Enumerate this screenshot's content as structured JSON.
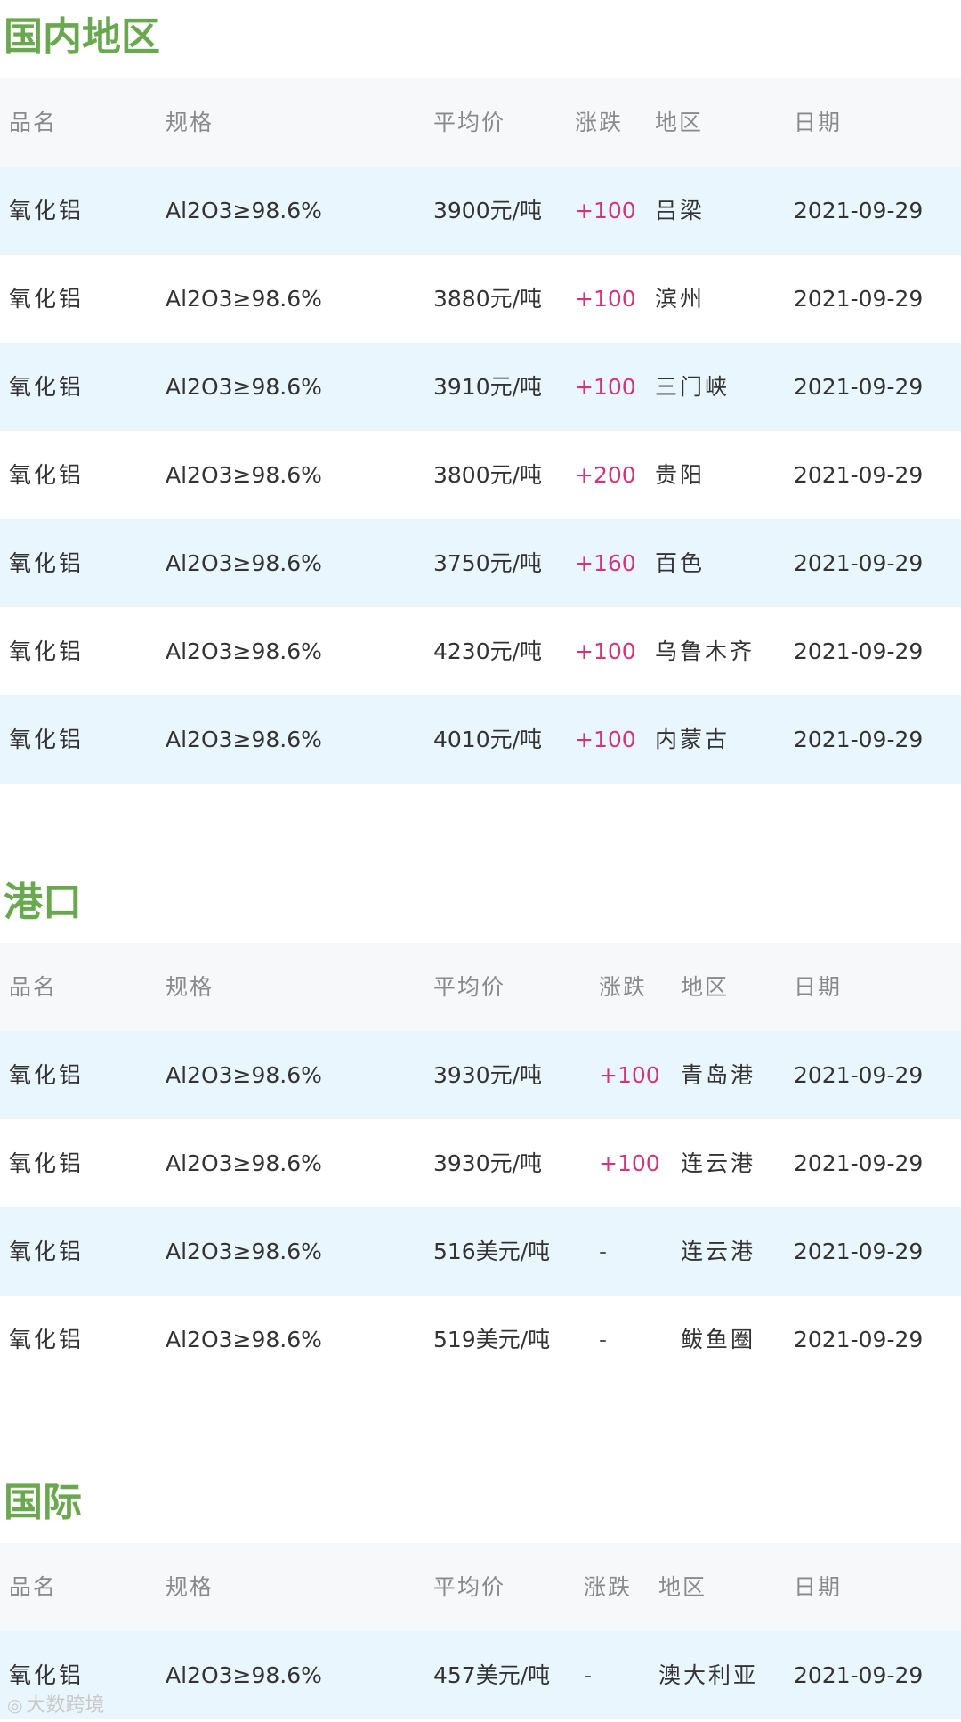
{
  "sections": [
    {
      "title": "国内地区",
      "header": {
        "name": "品名",
        "spec": "规格",
        "price": "平均价",
        "change": "涨跌",
        "region": "地区",
        "date": "日期"
      },
      "rows": [
        {
          "name": "氧化铝",
          "spec": "Al2O3≥98.6%",
          "price": "3900元/吨",
          "change": "+100",
          "region": "吕梁",
          "date": "2021-09-29"
        },
        {
          "name": "氧化铝",
          "spec": "Al2O3≥98.6%",
          "price": "3880元/吨",
          "change": "+100",
          "region": "滨州",
          "date": "2021-09-29"
        },
        {
          "name": "氧化铝",
          "spec": "Al2O3≥98.6%",
          "price": "3910元/吨",
          "change": "+100",
          "region": "三门峡",
          "date": "2021-09-29"
        },
        {
          "name": "氧化铝",
          "spec": "Al2O3≥98.6%",
          "price": "3800元/吨",
          "change": "+200",
          "region": "贵阳",
          "date": "2021-09-29"
        },
        {
          "name": "氧化铝",
          "spec": "Al2O3≥98.6%",
          "price": "3750元/吨",
          "change": "+160",
          "region": "百色",
          "date": "2021-09-29"
        },
        {
          "name": "氧化铝",
          "spec": "Al2O3≥98.6%",
          "price": "4230元/吨",
          "change": "+100",
          "region": "乌鲁木齐",
          "date": "2021-09-29"
        },
        {
          "name": "氧化铝",
          "spec": "Al2O3≥98.6%",
          "price": "4010元/吨",
          "change": "+100",
          "region": "内蒙古",
          "date": "2021-09-29"
        }
      ]
    },
    {
      "title": "港口",
      "header": {
        "name": "品名",
        "spec": "规格",
        "price": "平均价",
        "change": "涨跌",
        "region": "地区",
        "date": "日期"
      },
      "rows": [
        {
          "name": "氧化铝",
          "spec": "Al2O3≥98.6%",
          "price": "3930元/吨",
          "change": "+100",
          "region": "青岛港",
          "date": "2021-09-29"
        },
        {
          "name": "氧化铝",
          "spec": "Al2O3≥98.6%",
          "price": "3930元/吨",
          "change": "+100",
          "region": "连云港",
          "date": "2021-09-29"
        },
        {
          "name": "氧化铝",
          "spec": "Al2O3≥98.6%",
          "price": "516美元/吨",
          "change": "-",
          "region": "连云港",
          "date": "2021-09-29"
        },
        {
          "name": "氧化铝",
          "spec": "Al2O3≥98.6%",
          "price": "519美元/吨",
          "change": "-",
          "region": "鲅鱼圈",
          "date": "2021-09-29"
        }
      ]
    },
    {
      "title": "国际",
      "header": {
        "name": "品名",
        "spec": "规格",
        "price": "平均价",
        "change": "涨跌",
        "region": "地区",
        "date": "日期"
      },
      "rows": [
        {
          "name": "氧化铝",
          "spec": "Al2O3≥98.6%",
          "price": "457美元/吨",
          "change": "-",
          "region": "澳大利亚",
          "date": "2021-09-29"
        }
      ]
    }
  ],
  "watermark": {
    "text": "大数跨境",
    "icon": "logo-icon"
  },
  "colors": {
    "title": "#6aa84f",
    "change_up": "#d2337d",
    "row_alt": "#eaf6fe",
    "header_bg": "#f7f8fa"
  }
}
